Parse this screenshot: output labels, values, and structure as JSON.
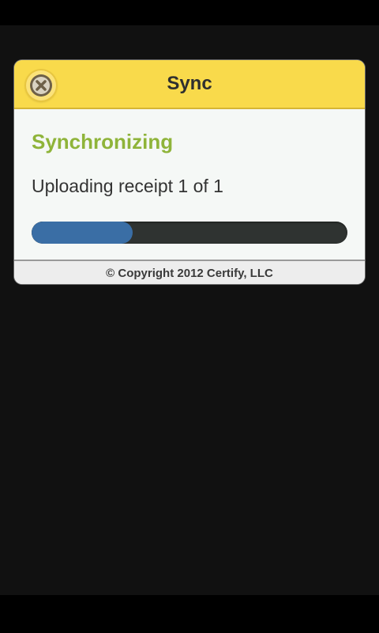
{
  "dialog": {
    "title": "Sync",
    "close_icon": "close-icon",
    "accent_color": "#f9da4b"
  },
  "status": {
    "heading": "Synchronizing",
    "heading_color": "#8fb43a",
    "message": "Uploading receipt 1 of 1"
  },
  "progress": {
    "fraction": 0.32,
    "fill_color": "#3a6ea5",
    "track_color": "#2f3331"
  },
  "footer": {
    "copyright": "© Copyright 2012 Certify, LLC"
  }
}
